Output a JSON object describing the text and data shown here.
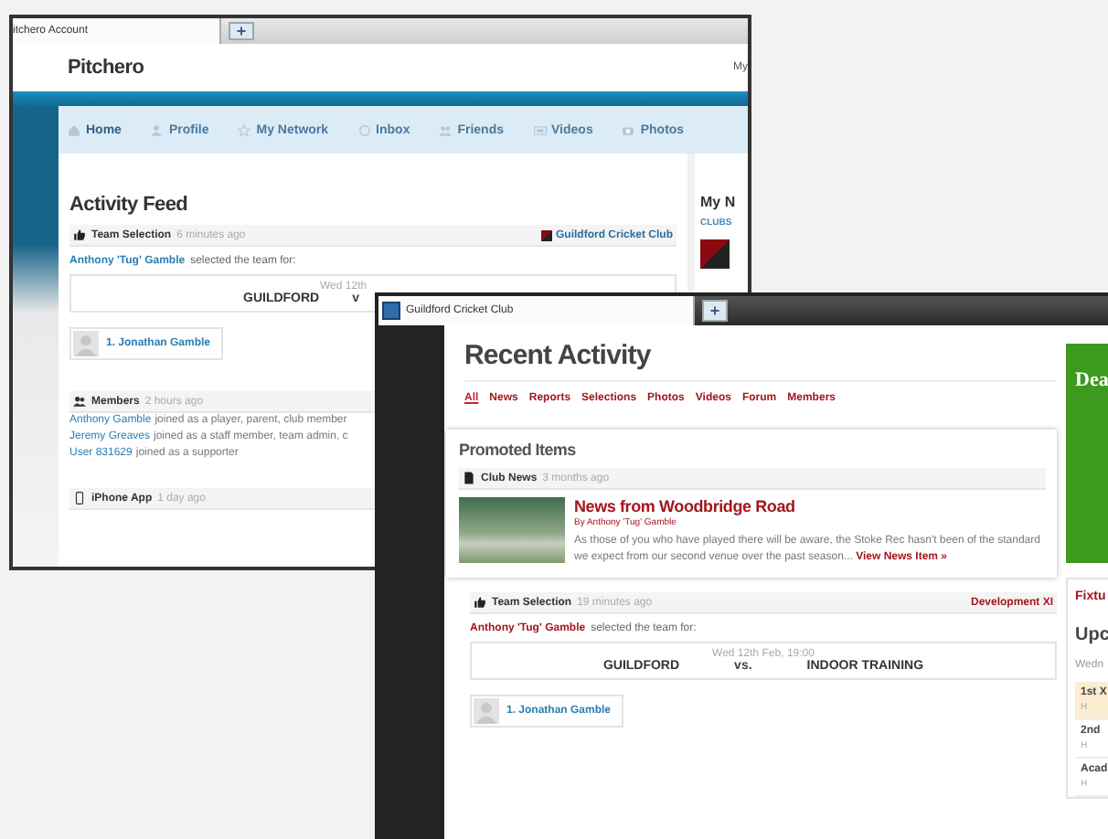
{
  "account_window": {
    "tab": "itchero Account",
    "new_tab": "+",
    "logo": "Pitchero",
    "header_link": "My",
    "nav": [
      {
        "label": "Home",
        "selected": true
      },
      {
        "label": "Profile",
        "selected": false
      },
      {
        "label": "My Network",
        "selected": false
      },
      {
        "label": "Inbox",
        "selected": false
      },
      {
        "label": "Friends",
        "selected": false
      },
      {
        "label": "Videos",
        "selected": false
      },
      {
        "label": "Photos",
        "selected": false
      }
    ],
    "heading": "Activity Feed",
    "feed": [
      {
        "kind": "selection",
        "type": "Team Selection",
        "time": "6 minutes ago",
        "club": "Guildford Cricket Club",
        "actor": "Anthony 'Tug' Gamble",
        "action": "selected the team for:",
        "date": "Wed 12th",
        "home": "GUILDFORD",
        "vs": "v",
        "player": "1. Jonathan Gamble"
      },
      {
        "kind": "members",
        "type": "Members",
        "time": "2 hours ago",
        "lines": [
          {
            "name": "Anthony Gamble",
            "text": "joined as a player, parent, club member"
          },
          {
            "name": "Jeremy Greaves",
            "text": "joined as a staff member, team admin, c"
          },
          {
            "name": "User 831629",
            "text": "joined as a supporter"
          }
        ]
      },
      {
        "kind": "app",
        "type": "iPhone App",
        "time": "1 day ago"
      }
    ],
    "side_heading": "My N",
    "side_label": "CLUBS"
  },
  "club_window": {
    "tab": "Guildford Cricket Club",
    "new_tab": "+",
    "heading": "Recent Activity",
    "filters": [
      {
        "label": "All",
        "selected": true
      },
      {
        "label": "News",
        "selected": false
      },
      {
        "label": "Reports",
        "selected": false
      },
      {
        "label": "Selections",
        "selected": false
      },
      {
        "label": "Photos",
        "selected": false
      },
      {
        "label": "Videos",
        "selected": false
      },
      {
        "label": "Forum",
        "selected": false
      },
      {
        "label": "Members",
        "selected": false
      }
    ],
    "promoted": {
      "heading": "Promoted Items",
      "type": "Club News",
      "time": "3 months ago",
      "title": "News from Woodbridge Road",
      "byline": "By Anthony 'Tug' Gamble",
      "body": "As those of you who have played there will be aware, the Stoke Rec hasn't been of the standard we expect from our second venue over the past season...",
      "link": "View News Item »"
    },
    "selection": {
      "type": "Team Selection",
      "time": "19 minutes ago",
      "team": "Development XI",
      "actor": "Anthony 'Tug' Gamble",
      "action": "selected the team for:",
      "date": "Wed 12th Feb, 19:00",
      "home": "GUILDFORD",
      "vs": "vs.",
      "away": "INDOOR TRAINING",
      "player": "1. Jonathan Gamble"
    },
    "banner": "Dea",
    "side_tab": "Fixtu",
    "side_heading": "Upc",
    "side_date": "Wedn",
    "fixtures": [
      {
        "label": "1st X",
        "mark": "H",
        "selected": true
      },
      {
        "label": "2nd",
        "mark": "H",
        "selected": false
      },
      {
        "label": "Acad",
        "mark": "H",
        "selected": false
      }
    ]
  }
}
